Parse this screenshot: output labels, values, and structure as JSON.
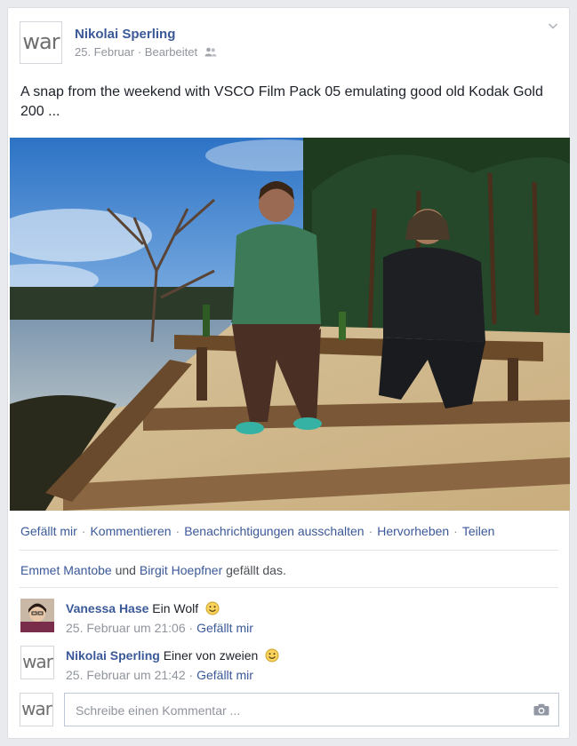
{
  "post": {
    "author": "Nikolai Sperling",
    "avatar_text": "war",
    "date": "25. Februar",
    "dot": "·",
    "edited": "Bearbeitet",
    "text": "A snap from the weekend with VSCO Film Pack 05 emulating good old Kodak Gold 200 ..."
  },
  "actions": {
    "like": "Gefällt mir",
    "comment": "Kommentieren",
    "notifications": "Benachrichtigungen ausschalten",
    "highlight": "Hervorheben",
    "share": "Teilen",
    "sep": "·"
  },
  "likes": {
    "person1": "Emmet Mantobe",
    "and": "und",
    "person2": "Birgit Hoepfner",
    "suffix": "gefällt das."
  },
  "comments": [
    {
      "author": "Vanessa Hase",
      "text": "Ein Wolf",
      "timestamp": "25. Februar um 21:06",
      "like": "Gefällt mir"
    },
    {
      "author": "Nikolai Sperling",
      "avatar_text": "war",
      "text": "Einer von zweien",
      "timestamp": "25. Februar um 21:42",
      "like": "Gefällt mir"
    }
  ],
  "composer": {
    "avatar_text": "war",
    "placeholder": "Schreibe einen Kommentar ..."
  },
  "colors": {
    "link": "#3b5998",
    "muted": "#90949c",
    "background": "#e9eaed"
  }
}
